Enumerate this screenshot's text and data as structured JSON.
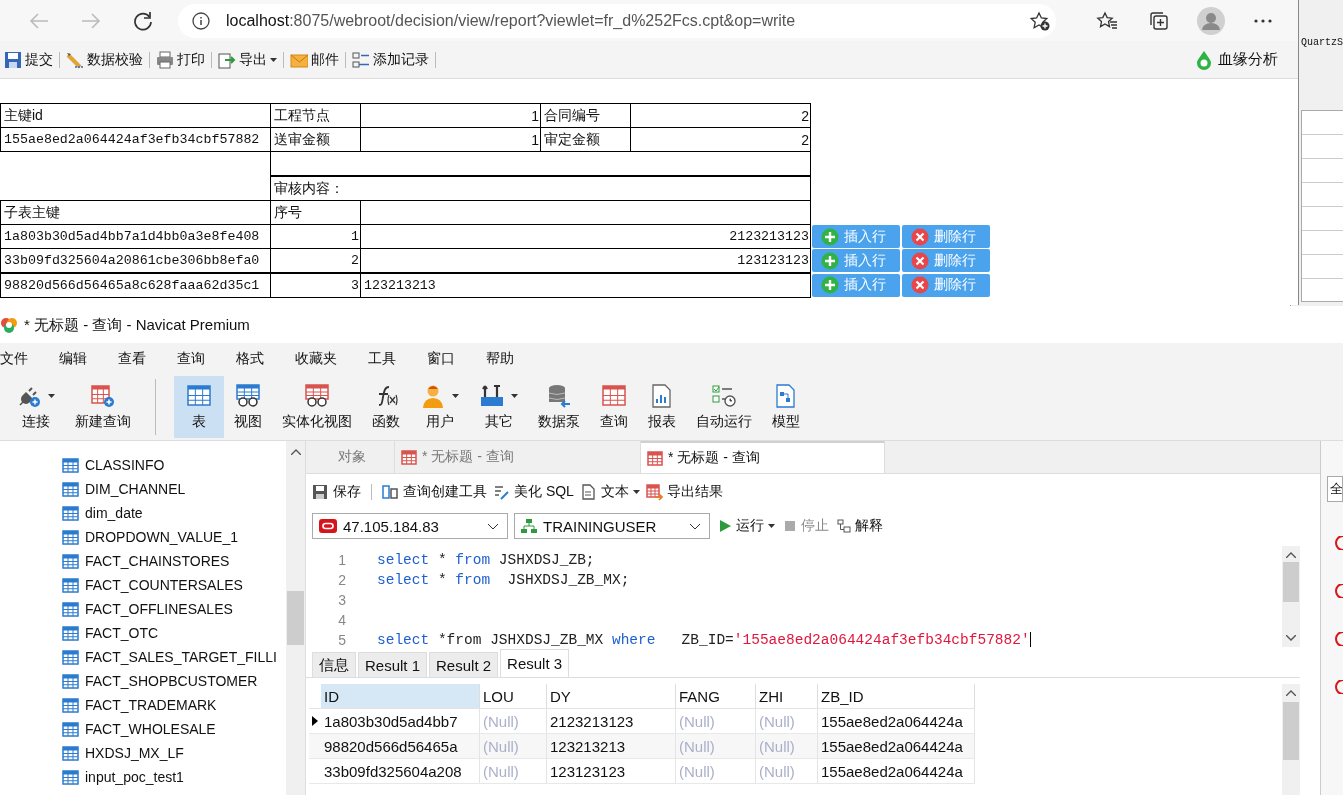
{
  "browser": {
    "url_host": "localhost",
    "url_path": ":8075/webroot/decision/view/report?viewlet=fr_d%252Fcs.cpt&op=write",
    "toolbar": [
      {
        "label": "提交",
        "dropdown": false
      },
      {
        "label": "数据校验",
        "dropdown": false
      },
      {
        "label": "打印",
        "dropdown": false
      },
      {
        "label": "导出",
        "dropdown": true
      },
      {
        "label": "邮件",
        "dropdown": false
      },
      {
        "label": "添加记录",
        "dropdown": false
      }
    ],
    "lineage": "血缘分析"
  },
  "form": {
    "pk_label": "主键id",
    "pk_value": "155ae8ed2a064424af3efb34cbf57882",
    "fields": [
      {
        "label": "工程节点",
        "value": "1"
      },
      {
        "label": "合同编号",
        "value": "2"
      },
      {
        "label": "送审金额",
        "value": "1"
      },
      {
        "label": "审定金额",
        "value": "2"
      }
    ],
    "review_label": "审核内容：",
    "detail_key_label": "子表主键",
    "detail_seq_label": "序号",
    "detail_rows": [
      {
        "key": "1a803b30d5ad4bb7a1d4bb0a3e8fe408",
        "seq": "1",
        "value": "2123213123",
        "kind": "number",
        "insert": "插入行",
        "delete": "删除行"
      },
      {
        "key": "33b09fd325604a20861cbe306bb8efa0",
        "seq": "2",
        "value": "123123123",
        "kind": "number",
        "insert": "插入行",
        "delete": "删除行"
      },
      {
        "key": "98820d566d56465a8c628faaa62d35c1",
        "seq": "3",
        "value": "123213213",
        "kind": "text",
        "insert": "插入行",
        "delete": "删除行"
      }
    ]
  },
  "background_window": {
    "title": "QuartzS"
  },
  "navicat": {
    "title": "* 无标题 - 查询 - Navicat Premium",
    "menu": [
      "文件",
      "编辑",
      "查看",
      "查询",
      "格式",
      "收藏夹",
      "工具",
      "窗口",
      "帮助"
    ],
    "toolbar": [
      {
        "label": "连接",
        "dropdown": true,
        "selected": false
      },
      {
        "label": "新建查询",
        "dropdown": false,
        "selected": false
      },
      {
        "label": "表",
        "dropdown": false,
        "selected": true
      },
      {
        "label": "视图",
        "dropdown": false,
        "selected": false
      },
      {
        "label": "实体化视图",
        "dropdown": false,
        "selected": false
      },
      {
        "label": "函数",
        "dropdown": false,
        "selected": false
      },
      {
        "label": "用户",
        "dropdown": true,
        "selected": false
      },
      {
        "label": "其它",
        "dropdown": true,
        "selected": false
      },
      {
        "label": "数据泵",
        "dropdown": false,
        "selected": false
      },
      {
        "label": "查询",
        "dropdown": false,
        "selected": false
      },
      {
        "label": "报表",
        "dropdown": false,
        "selected": false
      },
      {
        "label": "自动运行",
        "dropdown": false,
        "selected": false
      },
      {
        "label": "模型",
        "dropdown": false,
        "selected": false
      }
    ],
    "tree": [
      "CLASSINFO",
      "DIM_CHANNEL",
      "dim_date",
      "DROPDOWN_VALUE_1",
      "FACT_CHAINSTORES",
      "FACT_COUNTERSALES",
      "FACT_OFFLINESALES",
      "FACT_OTC",
      "FACT_SALES_TARGET_FILLI",
      "FACT_SHOPBCUSTOMER",
      "FACT_TRADEMARK",
      "FACT_WHOLESALE",
      "HXDSJ_MX_LF",
      "input_poc_test1"
    ],
    "tabs": [
      {
        "label": "对象",
        "selected": false
      },
      {
        "label": "* 无标题 - 查询",
        "selected": false
      },
      {
        "label": "* 无标题 - 查询",
        "selected": true
      }
    ],
    "query_toolbar": [
      {
        "label": "保存",
        "dropdown": false
      },
      {
        "label": "查询创建工具",
        "dropdown": false
      },
      {
        "label": "美化 SQL",
        "dropdown": false
      },
      {
        "label": "文本",
        "dropdown": true
      },
      {
        "label": "导出结果",
        "dropdown": false
      }
    ],
    "connection": "47.105.184.83",
    "database": "TRAININGUSER",
    "run": {
      "label": "运行",
      "disabled": false
    },
    "stop": {
      "label": "停止",
      "disabled": true
    },
    "explain": {
      "label": "解释",
      "disabled": false
    },
    "editor": [
      {
        "number": "1",
        "tokens": [
          {
            "text": "select",
            "kind": "keyword"
          },
          {
            "text": " * ",
            "kind": "plain"
          },
          {
            "text": "from",
            "kind": "keyword"
          },
          {
            "text": " JSHXDSJ_ZB;",
            "kind": "plain"
          }
        ]
      },
      {
        "number": "2",
        "tokens": [
          {
            "text": "select",
            "kind": "keyword"
          },
          {
            "text": " * ",
            "kind": "plain"
          },
          {
            "text": "from",
            "kind": "keyword"
          },
          {
            "text": "  JSHXDSJ_ZB_MX;",
            "kind": "plain"
          }
        ]
      },
      {
        "number": "3"
      },
      {
        "number": "4"
      },
      {
        "number": "5",
        "tokens": [
          {
            "text": "select",
            "kind": "keyword"
          },
          {
            "text": " *from JSHXDSJ_ZB_MX ",
            "kind": "plain"
          },
          {
            "text": "where",
            "kind": "keyword"
          },
          {
            "text": "   ZB_ID=",
            "kind": "plain"
          },
          {
            "text": "'155ae8ed2a064424af3efb34cbf57882'",
            "kind": "string"
          }
        ]
      }
    ],
    "result_tabs": [
      {
        "label": "信息",
        "selected": false
      },
      {
        "label": "Result 1",
        "selected": false
      },
      {
        "label": "Result 2",
        "selected": false
      },
      {
        "label": "Result 3",
        "selected": true
      }
    ],
    "result_columns": [
      {
        "label": "ID",
        "selected": true
      },
      {
        "label": "LOU",
        "selected": false
      },
      {
        "label": "DY",
        "selected": false
      },
      {
        "label": "FANG",
        "selected": false
      },
      {
        "label": "ZHI",
        "selected": false
      },
      {
        "label": "ZB_ID",
        "selected": false
      }
    ],
    "result_rows": [
      {
        "current": true,
        "cells": [
          {
            "text": "1a803b30d5ad4bb7",
            "is_null": false
          },
          {
            "text": "(Null)",
            "is_null": true
          },
          {
            "text": "2123213123",
            "is_null": false
          },
          {
            "text": "(Null)",
            "is_null": true
          },
          {
            "text": "(Null)",
            "is_null": true
          },
          {
            "text": "155ae8ed2a064424a",
            "is_null": false
          }
        ]
      },
      {
        "current": false,
        "cells": [
          {
            "text": "98820d566d56465a",
            "is_null": false
          },
          {
            "text": "(Null)",
            "is_null": true
          },
          {
            "text": "123213213",
            "is_null": false
          },
          {
            "text": "(Null)",
            "is_null": true
          },
          {
            "text": "(Null)",
            "is_null": true
          },
          {
            "text": "155ae8ed2a064424a",
            "is_null": false
          }
        ]
      },
      {
        "current": false,
        "cells": [
          {
            "text": "33b09fd325604a208",
            "is_null": false
          },
          {
            "text": "(Null)",
            "is_null": true
          },
          {
            "text": "123123123",
            "is_null": false
          },
          {
            "text": "(Null)",
            "is_null": true
          },
          {
            "text": "(Null)",
            "is_null": true
          },
          {
            "text": "155ae8ed2a064424a",
            "is_null": false
          }
        ]
      }
    ],
    "side_button": "全"
  }
}
